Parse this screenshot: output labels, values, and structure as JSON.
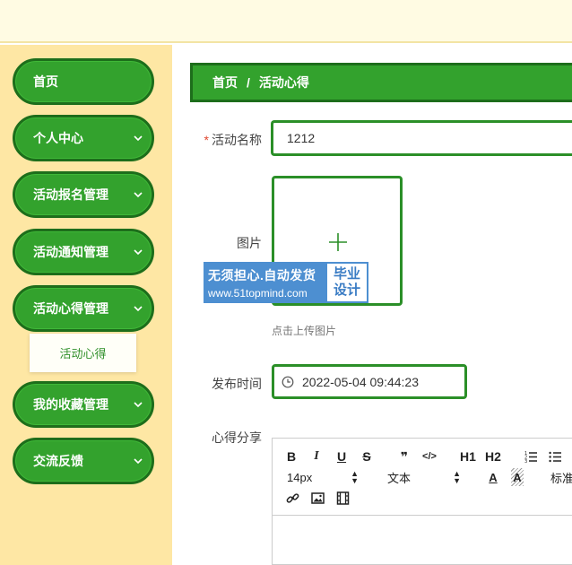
{
  "sidebar": {
    "items": [
      {
        "label": "首页"
      },
      {
        "label": "个人中心"
      },
      {
        "label": "活动报名管理"
      },
      {
        "label": "活动通知管理"
      },
      {
        "label": "活动心得管理"
      },
      {
        "label": "我的收藏管理"
      },
      {
        "label": "交流反馈"
      }
    ],
    "submenu": {
      "label": "活动心得"
    }
  },
  "breadcrumb": {
    "home": "首页",
    "separator": "/",
    "current": "活动心得"
  },
  "form": {
    "name": {
      "required_mark": "*",
      "label": "活动名称",
      "value": "1212"
    },
    "image": {
      "label": "图片",
      "hint": "点击上传图片"
    },
    "publish_time": {
      "label": "发布时间",
      "value": "2022-05-04 09:44:23"
    },
    "content": {
      "label": "心得分享"
    }
  },
  "editor": {
    "bold": "B",
    "italic": "I",
    "underline": "U",
    "strike": "S",
    "quote": "❞",
    "code": "</>",
    "h1": "H1",
    "h2": "H2",
    "font_size": "14px",
    "font_type": "文本",
    "font_color": "A",
    "bg_color": "A",
    "standard": "标准"
  },
  "watermark": {
    "line1": "无须担心.自动发货",
    "line2": "www.51topmind.com",
    "badge1": "毕业",
    "badge2": "设计"
  },
  "colors": {
    "primary_green": "#33a22d",
    "border_green": "#1d6e1b",
    "sidebar_bg": "#fee7a4",
    "topbar_bg": "#fffbe3",
    "watermark_blue": "#4d8fd1"
  }
}
